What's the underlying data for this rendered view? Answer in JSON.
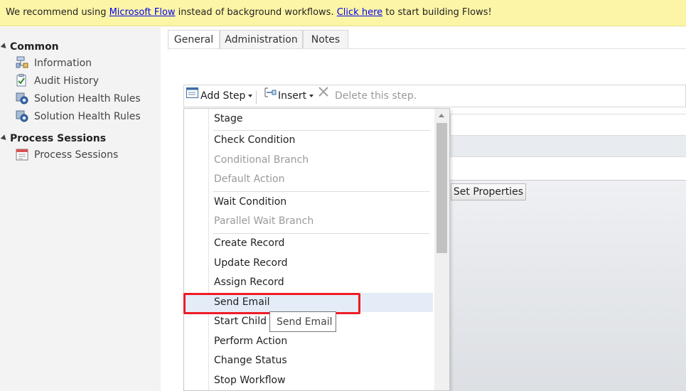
{
  "banner": {
    "text_prefix": "We recommend using ",
    "link1": "Microsoft Flow",
    "text_middle": " instead of background workflows. ",
    "link2": "Click here",
    "text_suffix": " to start building Flows!"
  },
  "sidebar": {
    "common_title": "Common",
    "common_items": [
      {
        "label": "Information",
        "icon": "information-icon"
      },
      {
        "label": "Audit History",
        "icon": "audit-history-icon"
      },
      {
        "label": "Solution Health Rules",
        "icon": "gear-icon"
      },
      {
        "label": "Solution Health Rules",
        "icon": "gear-icon"
      }
    ],
    "process_title": "Process Sessions",
    "process_items": [
      {
        "label": "Process Sessions",
        "icon": "calendar-icon"
      }
    ]
  },
  "tabs": [
    "General",
    "Administration",
    "Notes"
  ],
  "toolbar": {
    "add_step": "Add Step",
    "insert": "Insert",
    "delete": "Delete this step."
  },
  "menu": {
    "items": [
      "Stage",
      "Check Condition",
      "Conditional Branch",
      "Default Action",
      "Wait Condition",
      "Parallel Wait Branch",
      "Create Record",
      "Update Record",
      "Assign Record",
      "Send Email",
      "Start Child Workflow",
      "Perform Action",
      "Change Status",
      "Stop Workflow"
    ],
    "start_child_visible": "Start Child W"
  },
  "tooltip": "Send Email",
  "set_properties": "Set Properties",
  "colors": {
    "banner_bg": "#fdf5a6",
    "highlight": "#ee1c25",
    "hover_bg": "#e4ecf7",
    "link": "#0000ee"
  }
}
